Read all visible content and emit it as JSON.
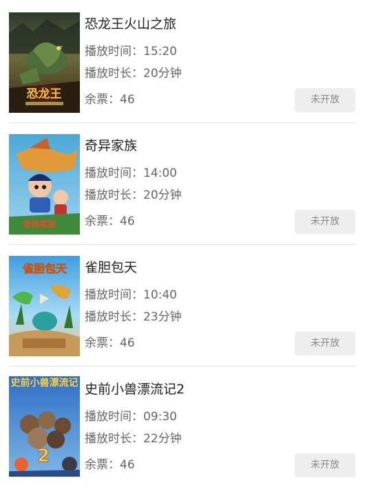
{
  "movies": [
    {
      "title": "恐龙王火山之旅",
      "time_label": "播放时间：",
      "time": "15:20",
      "duration_label": "播放时长：",
      "duration": "20分钟",
      "tickets_label": "余票：",
      "tickets": "46",
      "button": "未开放",
      "poster_text": "恐龙王"
    },
    {
      "title": "奇异家族",
      "time_label": "播放时间：",
      "time": "14:00",
      "duration_label": "播放时长：",
      "duration": "20分钟",
      "tickets_label": "余票：",
      "tickets": "46",
      "button": "未开放",
      "poster_text": "奇异家族"
    },
    {
      "title": "雀胆包天",
      "time_label": "播放时间：",
      "time": "10:40",
      "duration_label": "播放时长：",
      "duration": "23分钟",
      "tickets_label": "余票：",
      "tickets": "46",
      "button": "未开放",
      "poster_text": "雀胆包天"
    },
    {
      "title": "史前小兽漂流记2",
      "time_label": "播放时间：",
      "time": "09:30",
      "duration_label": "播放时长：",
      "duration": "22分钟",
      "tickets_label": "余票：",
      "tickets": "46",
      "button": "未开放",
      "poster_text": "史前小兽漂流记",
      "poster_number": "2"
    }
  ]
}
